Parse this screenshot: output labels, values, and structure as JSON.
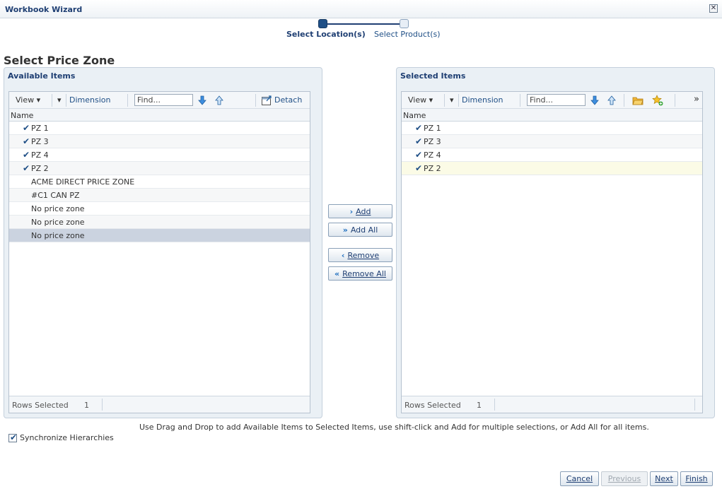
{
  "window": {
    "title": "Workbook Wizard",
    "close_glyph": "✕"
  },
  "train": {
    "steps": [
      "Select Location(s)",
      "Select Product(s)"
    ]
  },
  "page_title": "Select Price Zone",
  "available": {
    "title": "Available Items",
    "toolbar": {
      "view": "View ▾",
      "dimension": "Dimension",
      "find_placeholder": "Find...",
      "detach": "Detach"
    },
    "column": "Name",
    "rows": [
      {
        "label": "PZ 1",
        "checked": true
      },
      {
        "label": "PZ 3",
        "checked": true
      },
      {
        "label": "PZ 4",
        "checked": true
      },
      {
        "label": "PZ 2",
        "checked": true
      },
      {
        "label": "ACME DIRECT PRICE ZONE",
        "checked": false
      },
      {
        "label": "#C1 CAN PZ",
        "checked": false
      },
      {
        "label": "No price zone",
        "checked": false
      },
      {
        "label": "No price zone",
        "checked": false
      },
      {
        "label": "No price zone",
        "checked": false
      }
    ],
    "footer": {
      "label": "Rows Selected",
      "count": "1"
    }
  },
  "selected": {
    "title": "Selected Items",
    "toolbar": {
      "view": "View ▾",
      "dimension": "Dimension",
      "find_placeholder": "Find...",
      "more": "»"
    },
    "column": "Name",
    "rows": [
      {
        "label": "PZ 1",
        "checked": true
      },
      {
        "label": "PZ 3",
        "checked": true
      },
      {
        "label": "PZ 4",
        "checked": true
      },
      {
        "label": "PZ 2",
        "checked": true
      }
    ],
    "footer": {
      "label": "Rows Selected",
      "count": "1"
    }
  },
  "shuttle": {
    "add": "Add",
    "add_all": "Add All",
    "remove": "Remove",
    "remove_all": "Remove All"
  },
  "hint": "Use Drag and Drop to add Available Items to Selected Items, use shift-click and Add for multiple selections, or Add All for all items.",
  "sync_label": "Synchronize Hierarchies",
  "nav": {
    "cancel": "Cancel",
    "previous": "Previous",
    "next": "Next",
    "finish": "Finish"
  },
  "check_glyph": "✔"
}
